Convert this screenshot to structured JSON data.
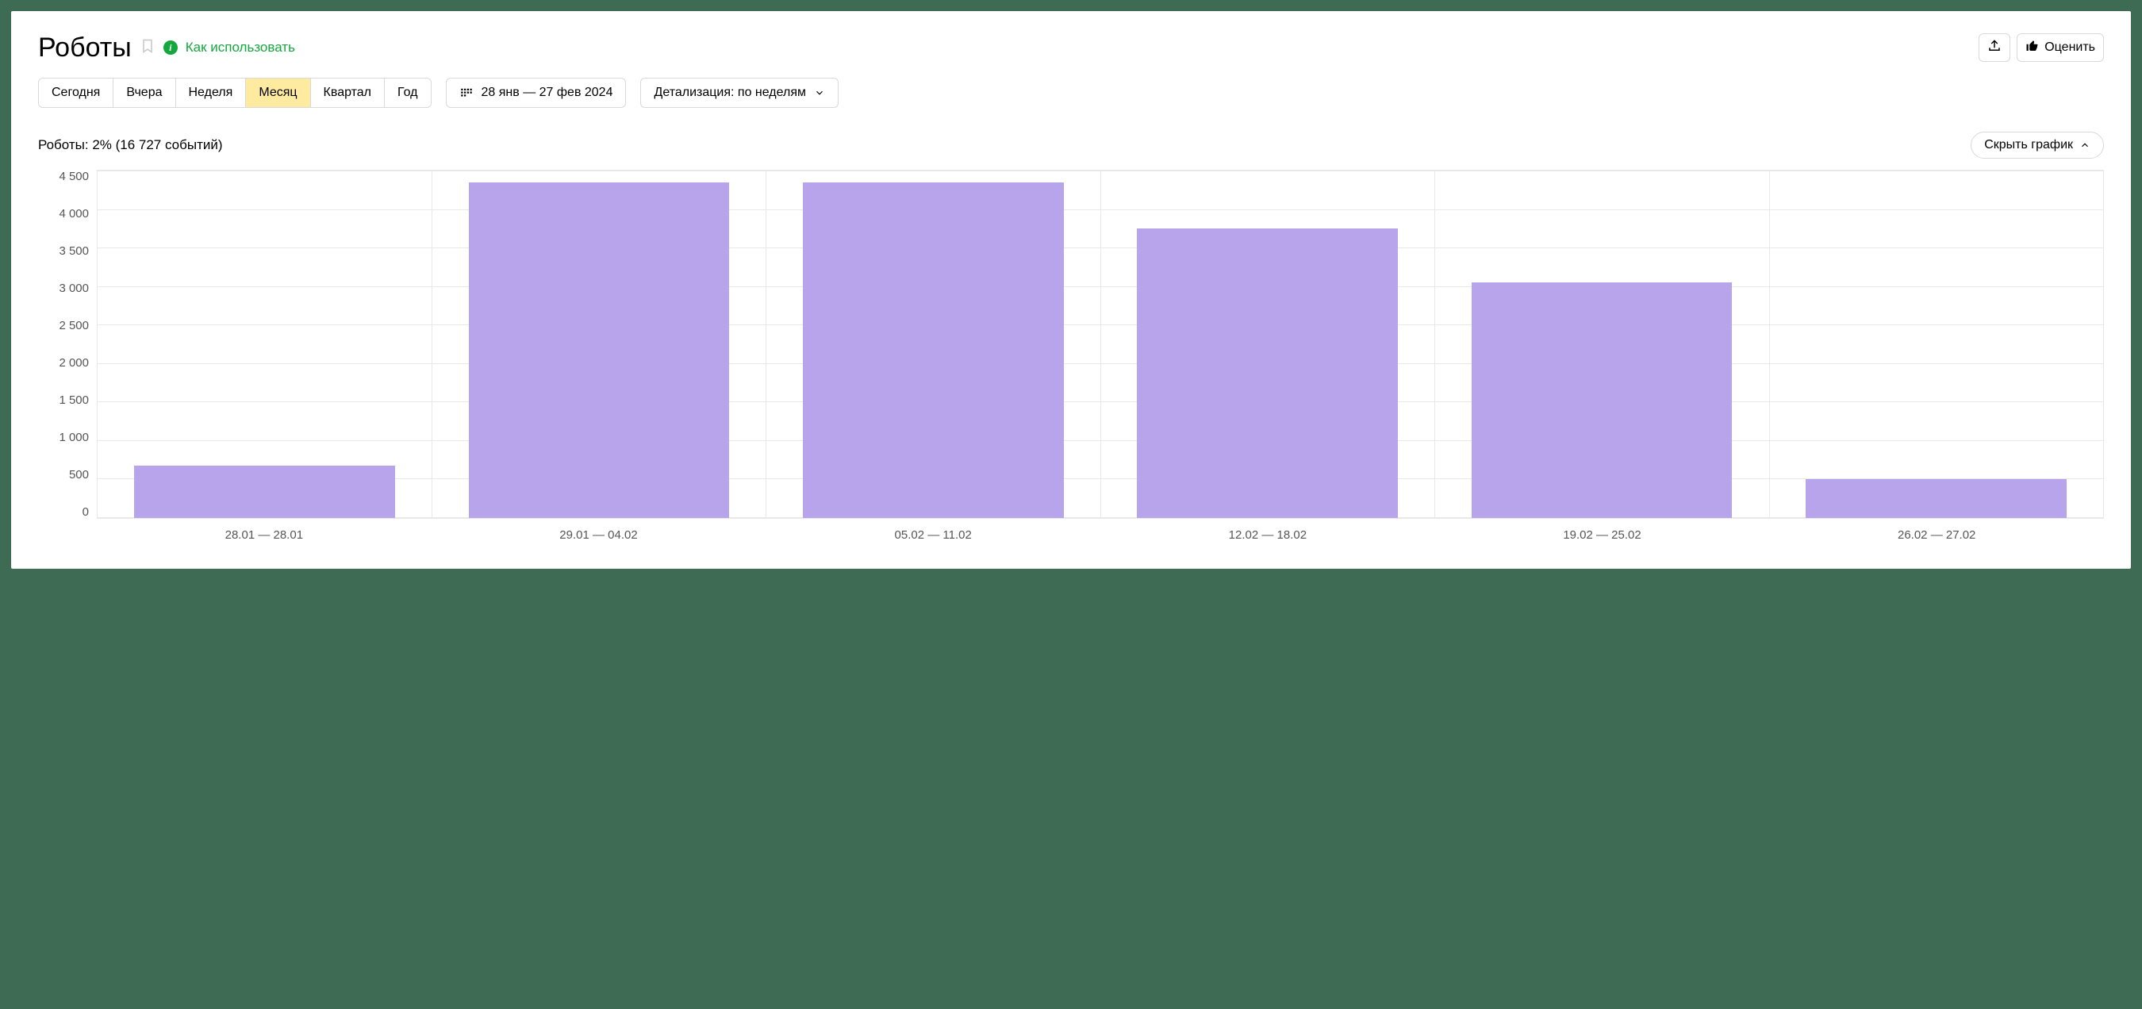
{
  "header": {
    "title": "Роботы",
    "howto_label": "Как использовать",
    "rate_label": "Оценить"
  },
  "toolbar": {
    "periods": [
      "Сегодня",
      "Вчера",
      "Неделя",
      "Месяц",
      "Квартал",
      "Год"
    ],
    "selected_period_index": 3,
    "date_range": "28 янв — 27 фев 2024",
    "detail_label": "Детализация: по неделям"
  },
  "summary": {
    "text": "Роботы: 2% (16 727 событий)",
    "toggle_label": "Скрыть график"
  },
  "chart_data": {
    "type": "bar",
    "title": "",
    "xlabel": "",
    "ylabel": "",
    "ylim": [
      0,
      4500
    ],
    "y_ticks": [
      "4 500",
      "4 000",
      "3 500",
      "3 000",
      "2 500",
      "2 000",
      "1 500",
      "1 000",
      "500",
      "0"
    ],
    "categories": [
      "28.01 — 28.01",
      "29.01 — 04.02",
      "05.02 — 11.02",
      "12.02 — 18.02",
      "19.02 — 25.02",
      "26.02 — 27.02"
    ],
    "values": [
      680,
      4350,
      4350,
      3750,
      3050,
      500
    ],
    "bar_color": "#b8a4ea"
  }
}
